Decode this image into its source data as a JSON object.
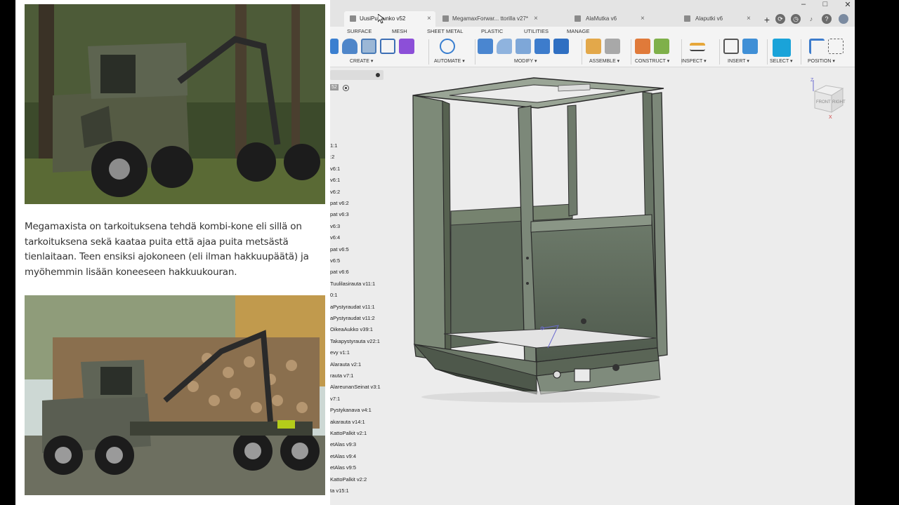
{
  "blog": {
    "paragraph": "Megamaxista on tarkoituksena tehdä kombi-kone eli sillä on tarkoituksena sekä kaataa puita että ajaa puita metsästä tienlaitaan. Teen ensiksi ajokoneen (eli ilman hakkuupäätä) ja myöhemmin lisään koneeseen hakkuukouran."
  },
  "fusion": {
    "tabs": [
      {
        "label": "UusiPuurunko v52"
      },
      {
        "label": "MegamaxForwar... ttorilla v27*"
      },
      {
        "label": "AlaMutka v6"
      },
      {
        "label": "Alaputki v6"
      }
    ],
    "workspace_tabs": [
      "SURFACE",
      "MESH",
      "SHEET METAL",
      "PLASTIC",
      "UTILITIES",
      "MANAGE"
    ],
    "groups": [
      "CREATE ▾",
      "AUTOMATE ▾",
      "MODIFY ▾",
      "ASSEMBLE ▾",
      "CONSTRUCT ▾",
      "INSPECT ▾",
      "INSERT ▾",
      "SELECT ▾",
      "POSITION ▾"
    ],
    "browser": {
      "version_badge": "52",
      "items": [
        "1:1",
        ":2",
        "v6:1",
        "v6:1",
        "v6:2",
        "pat v6:2",
        "pat v6:3",
        "v6:3",
        "v6:4",
        "pat v6:5",
        "v6:5",
        "pat v6:6",
        "Tuulilasirauta v11:1",
        "0:1",
        "aPystyraudat v11:1",
        "aPystyraudat v11:2",
        "OikeaAukko v39:1",
        "Takapystyrauta v22:1",
        "evy v1:1",
        "Alarauta v2:1",
        "rauta v7:1",
        "AlareunanSeinat v3:1",
        "v7:1",
        "Pystykanava v4:1",
        "akarauta v14:1",
        "KattoPalkit v2:1",
        "etAlas v9:3",
        "etAlas v9:4",
        "etAlas v9:5",
        "KattoPalkit v2:2",
        "ta v15:1"
      ]
    },
    "viewcube": {
      "face_front": "FRONT",
      "face_right": "RIGHT",
      "axis_z": "Z",
      "axis_x": "X"
    },
    "colors": {
      "accent_select": "#1aa3d9",
      "model_fill": "#5f6b5d"
    }
  }
}
